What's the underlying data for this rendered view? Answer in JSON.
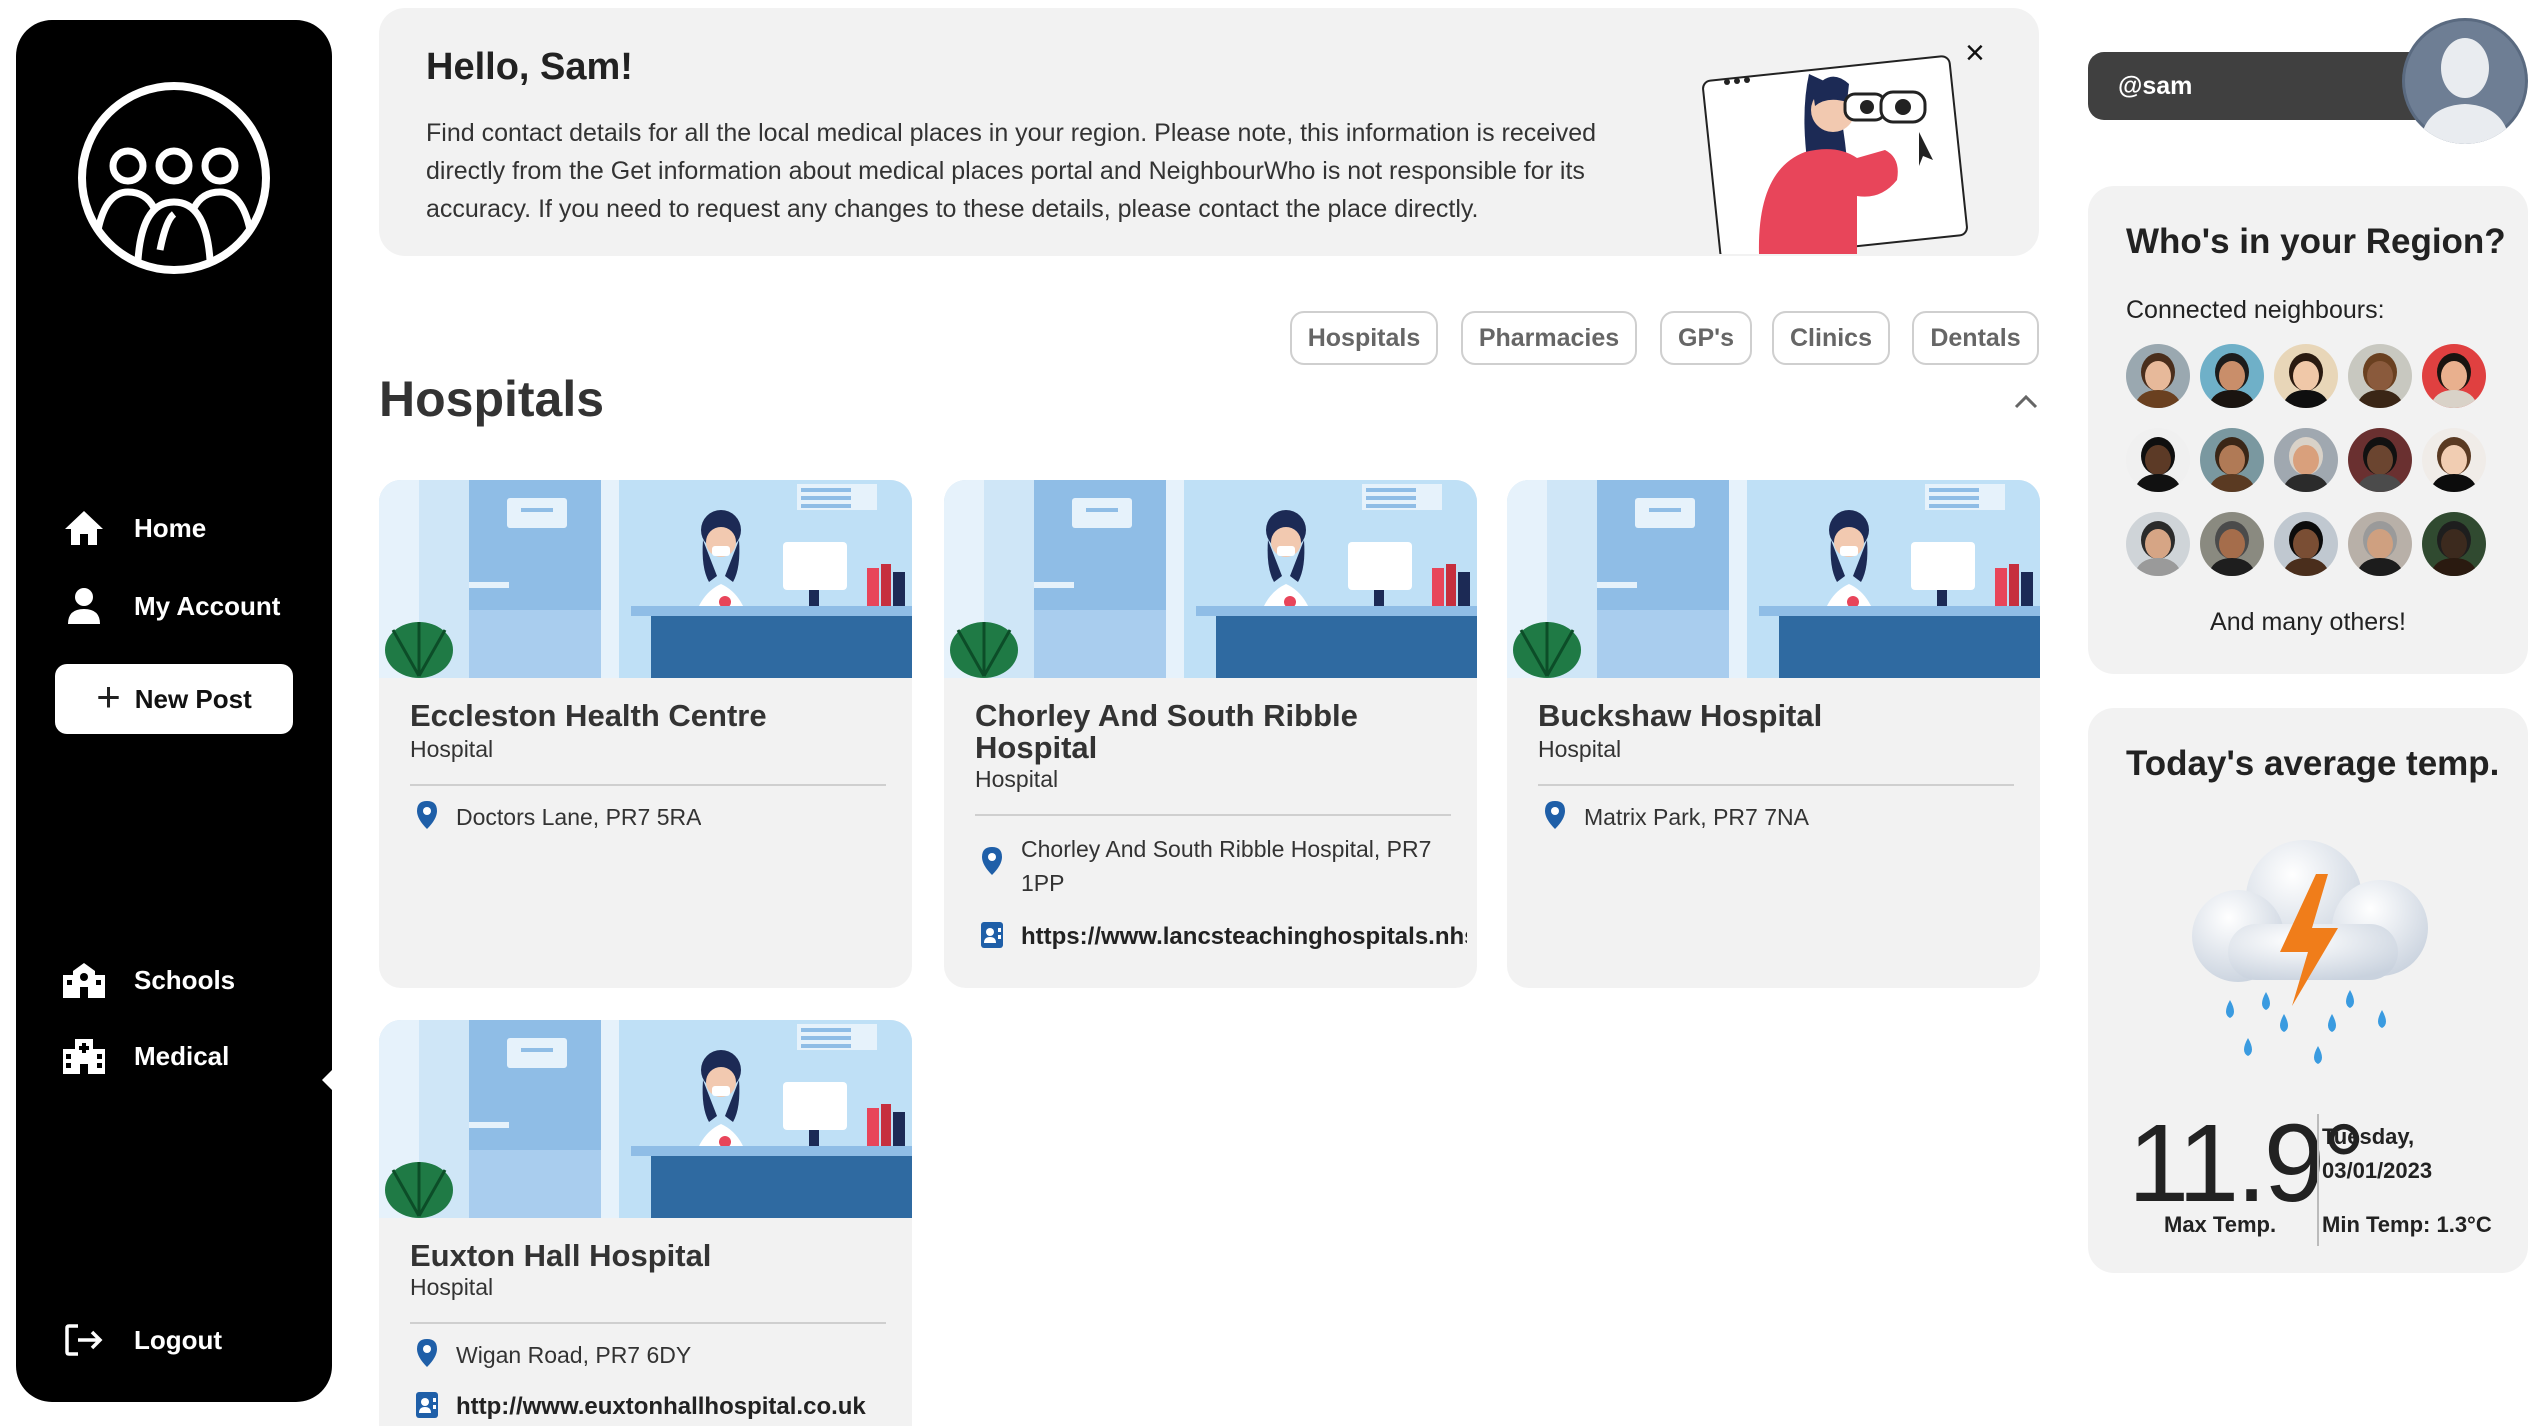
{
  "sidebar": {
    "nav": [
      {
        "label": "Home",
        "icon": "home-icon"
      },
      {
        "label": "My Account",
        "icon": "user-icon"
      },
      {
        "label": "Schools",
        "icon": "school-icon"
      },
      {
        "label": "Medical",
        "icon": "medical-building-icon"
      },
      {
        "label": "Logout",
        "icon": "logout-icon"
      }
    ],
    "new_post_label": "New Post",
    "active_item": "Medical"
  },
  "banner": {
    "title": "Hello, Sam!",
    "text": "Find contact details for all the local medical places in your region. Please note, this information is received directly from the Get information about medical places portal and NeighbourWho is not responsible for its accuracy. If you need to request any changes to these details, please contact the place directly.",
    "close_symbol": "×"
  },
  "filters": [
    "Hospitals",
    "Pharmacies",
    "GP's",
    "Clinics",
    "Dentals"
  ],
  "section": {
    "title": "Hospitals"
  },
  "places": [
    {
      "name": "Eccleston Health Centre",
      "type": "Hospital",
      "address": "Doctors Lane, PR7 5RA"
    },
    {
      "name": "Chorley And South Ribble Hospital",
      "type": "Hospital",
      "address": "Chorley And South Ribble Hospital, PR7 1PP",
      "website": "https://www.lancsteachinghospitals.nhs.uk"
    },
    {
      "name": "Buckshaw Hospital",
      "type": "Hospital",
      "address": "Matrix Park, PR7 7NA"
    },
    {
      "name": "Euxton Hall Hospital",
      "type": "Hospital",
      "address": "Wigan Road, PR7 6DY",
      "website": "http://www.euxtonhallhospital.co.uk"
    }
  ],
  "user": {
    "handle": "@sam"
  },
  "region": {
    "title": "Who's in your Region?",
    "subtitle": "Connected neighbours:",
    "more": "And many others!",
    "neighbour_count": 15
  },
  "weather": {
    "title": "Today's average temp.",
    "average_temp": "11.9°",
    "day": "Tuesday,",
    "date": "03/01/2023",
    "max_label": "Max Temp.",
    "min_label": "Min Temp: 1.3°C",
    "icon": "thunderstorm-icon"
  },
  "colors": {
    "sidebar": "#000000",
    "panel": "#f2f2f2",
    "pin": "#1f5fa8",
    "accent_red": "#e8455a",
    "lightning": "#f07d1a",
    "rain": "#3a9be0"
  }
}
